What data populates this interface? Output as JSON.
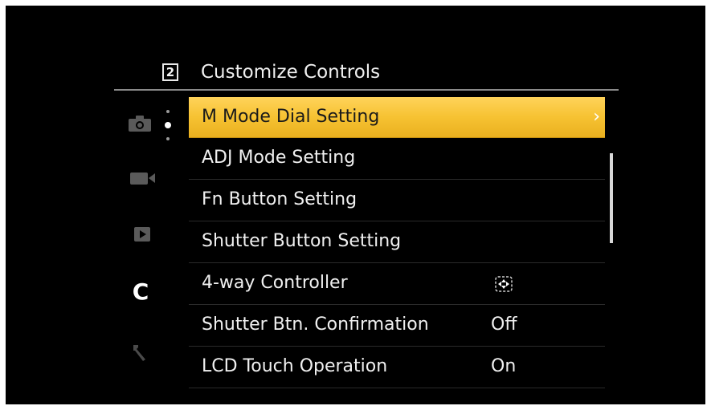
{
  "header": {
    "page_number": "2",
    "title": "Customize Controls"
  },
  "tabs": [
    {
      "name": "shooting-tab",
      "icon": "camera-icon",
      "active": false
    },
    {
      "name": "movie-tab",
      "icon": "video-camera-icon",
      "active": false
    },
    {
      "name": "playback-tab",
      "icon": "play-icon",
      "active": false
    },
    {
      "name": "custom-tab",
      "icon": "c-letter-icon",
      "active": true
    },
    {
      "name": "setup-tab",
      "icon": "wrench-icon",
      "active": false
    }
  ],
  "custom_tab_label": "C",
  "menu": {
    "items": [
      {
        "label": "M Mode Dial Setting",
        "value": "",
        "selected": true,
        "chevron": "›"
      },
      {
        "label": "ADJ Mode Setting",
        "value": ""
      },
      {
        "label": "Fn Button Setting",
        "value": ""
      },
      {
        "label": "Shutter Button Setting",
        "value": ""
      },
      {
        "label": "4-way Controller",
        "value": "",
        "icon": "four-way-controller-icon"
      },
      {
        "label": "Shutter Btn. Confirmation",
        "value": "Off"
      },
      {
        "label": "LCD Touch Operation",
        "value": "On"
      }
    ]
  },
  "colors": {
    "selection": "#f6c232",
    "background": "#000000",
    "text": "#f0f0f0"
  }
}
